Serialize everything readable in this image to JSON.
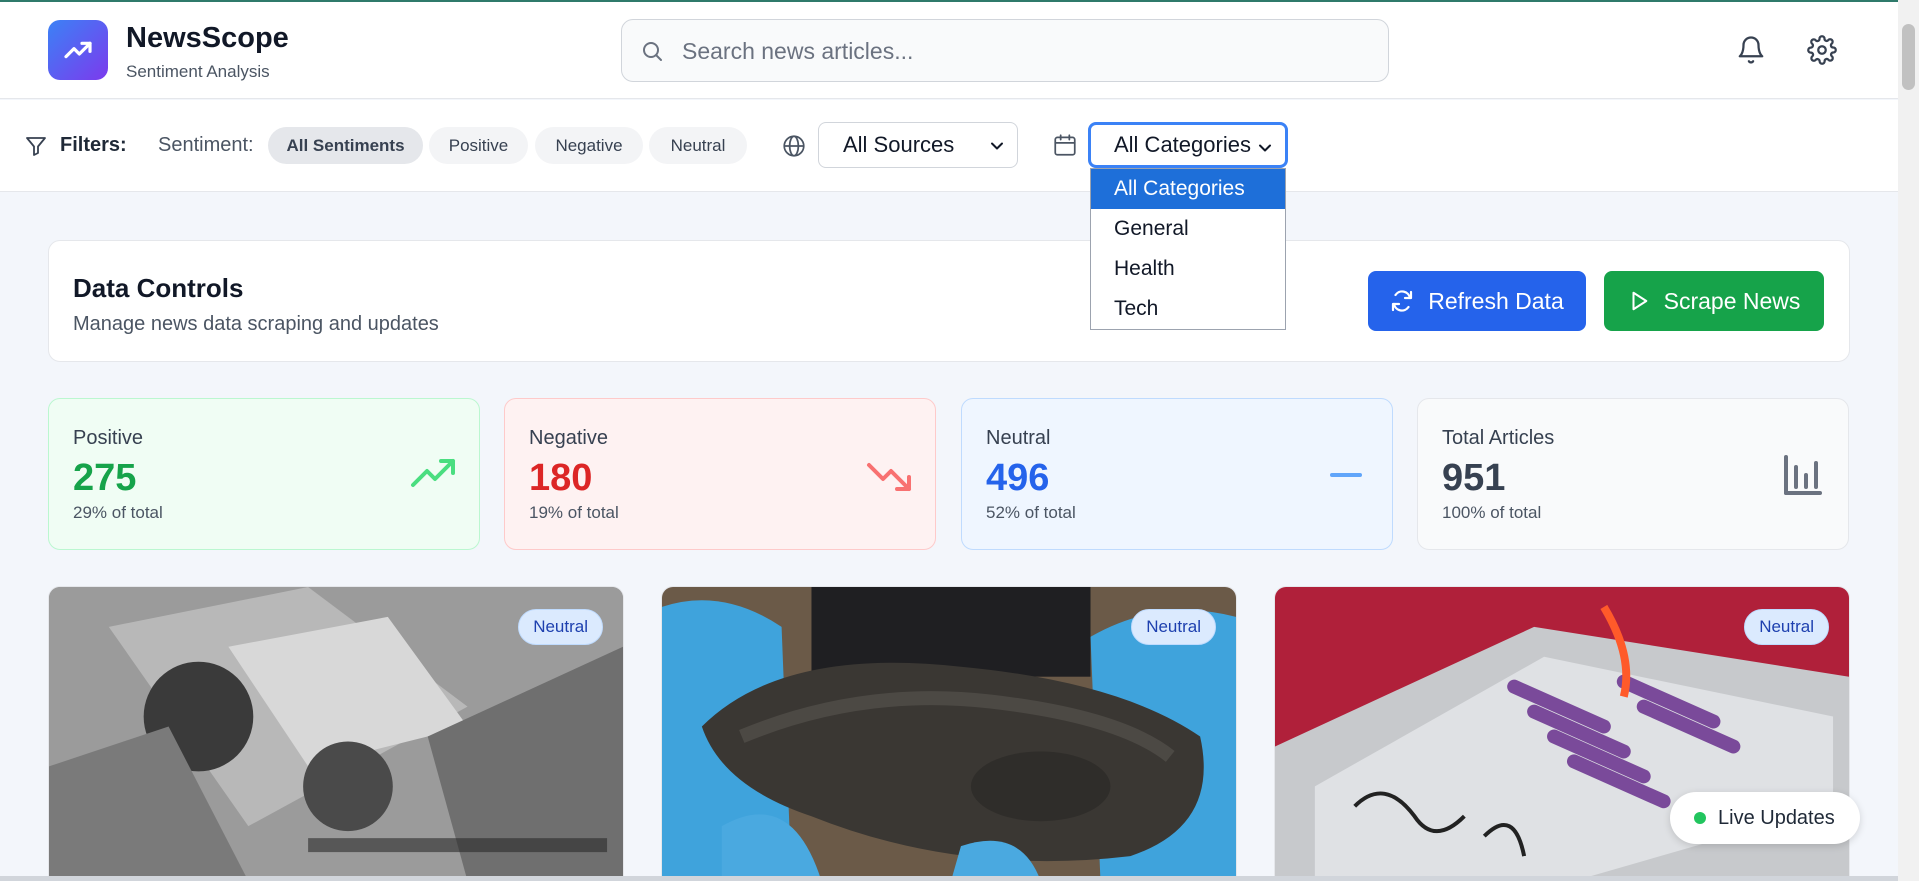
{
  "app": {
    "title": "NewsScope",
    "subtitle": "Sentiment Analysis"
  },
  "header": {
    "search_placeholder": "Search news articles...",
    "icons": [
      "trending-up-icon",
      "search-icon",
      "bell-icon",
      "gear-icon"
    ]
  },
  "filters": {
    "label": "Filters:",
    "sentiment_label": "Sentiment:",
    "chips": [
      "All Sentiments",
      "Positive",
      "Negative",
      "Neutral"
    ],
    "active_chip": "All Sentiments",
    "source_value": "All Sources",
    "category_value": "All Categories",
    "category_options": [
      "All Categories",
      "General",
      "Health",
      "Tech"
    ]
  },
  "controls": {
    "title": "Data Controls",
    "description": "Manage news data scraping and updates",
    "refresh_label": "Refresh Data",
    "scrape_label": "Scrape News"
  },
  "stats": {
    "positive": {
      "label": "Positive",
      "value": "275",
      "pct": "29% of total"
    },
    "negative": {
      "label": "Negative",
      "value": "180",
      "pct": "19% of total"
    },
    "neutral": {
      "label": "Neutral",
      "value": "496",
      "pct": "52% of total"
    },
    "total": {
      "label": "Total Articles",
      "value": "951",
      "pct": "100% of total"
    }
  },
  "articles": [
    {
      "badge": "Neutral",
      "image": "aerial grayscale photo"
    },
    {
      "badge": "Neutral",
      "image": "ancient leather sandal held in blue gloves"
    },
    {
      "badge": "Neutral",
      "image": "syringes on metal tray"
    }
  ],
  "live": {
    "label": "Live Updates"
  },
  "colors": {
    "primary_blue": "#2563eb",
    "primary_green": "#16a34a",
    "positive": "#16a34a",
    "negative": "#dc2626",
    "neutral": "#2563eb",
    "total": "#374151"
  }
}
